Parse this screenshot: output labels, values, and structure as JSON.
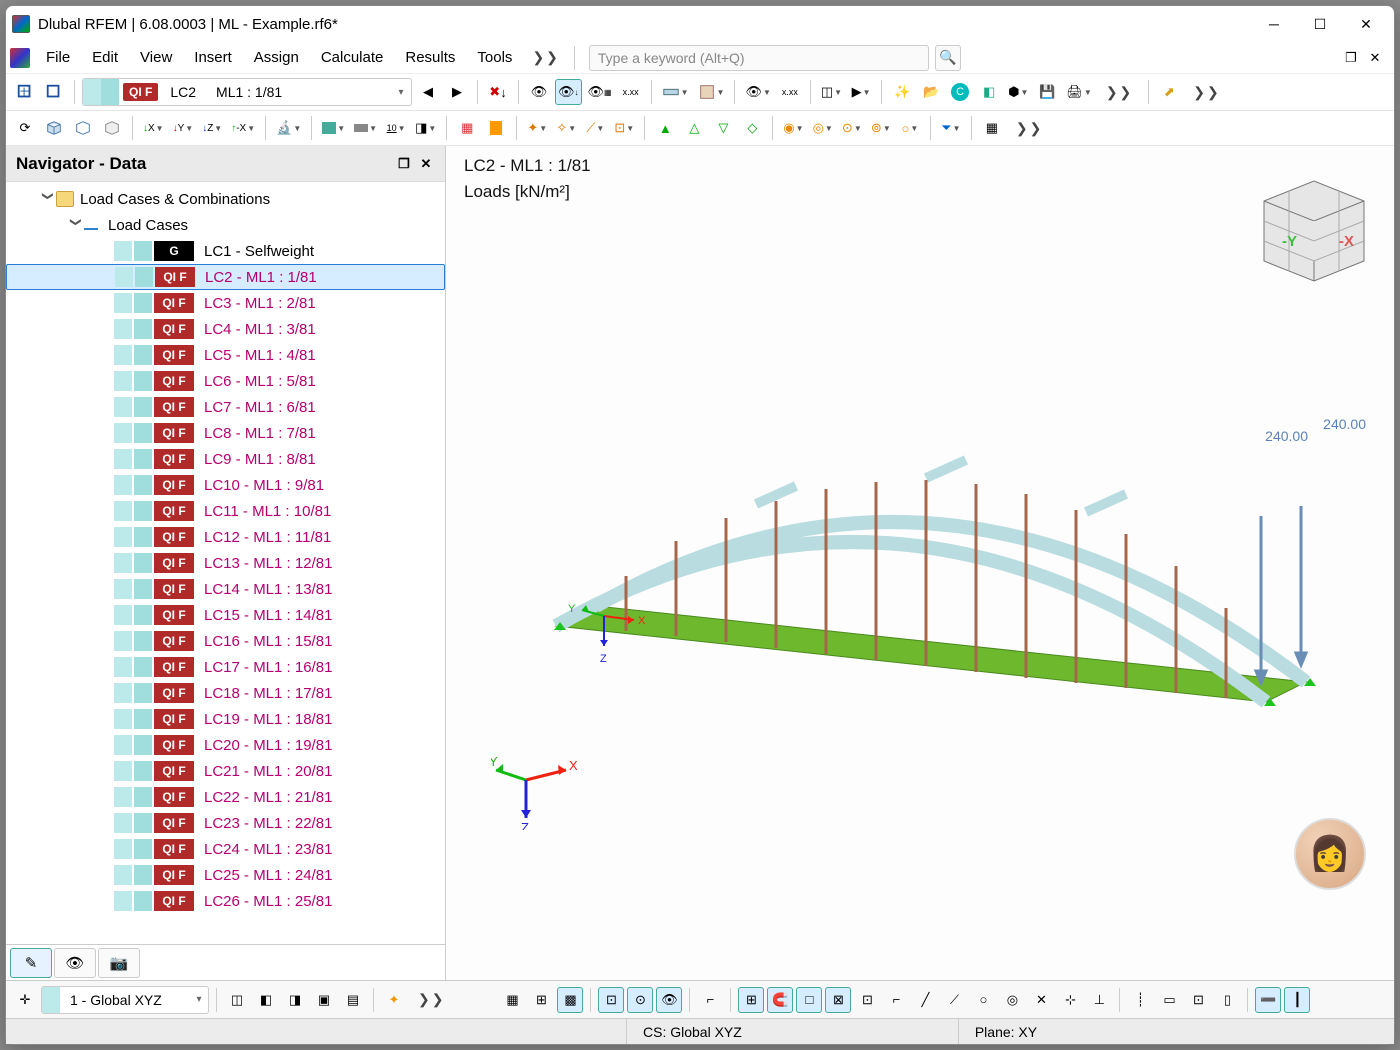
{
  "title": "Dlubal RFEM | 6.08.0003 | ML - Example.rf6*",
  "menu": {
    "file": "File",
    "edit": "Edit",
    "view": "View",
    "insert": "Insert",
    "assign": "Assign",
    "calculate": "Calculate",
    "results": "Results",
    "tools": "Tools"
  },
  "search": {
    "placeholder": "Type a keyword (Alt+Q)"
  },
  "toolbar1": {
    "lc_badge": "QI F",
    "lc_code": "LC2",
    "lc_desc": "ML1 : 1/81"
  },
  "navigator": {
    "title": "Navigator - Data",
    "group": "Load Cases & Combinations",
    "subgroup": "Load Cases",
    "items": [
      {
        "cat": "G",
        "catClass": "g",
        "label": "LC1 - Selfweight",
        "first": true
      },
      {
        "cat": "QI F",
        "catClass": "qif",
        "label": "LC2 - ML1 : 1/81",
        "selected": true
      },
      {
        "cat": "QI F",
        "catClass": "qif",
        "label": "LC3 - ML1 : 2/81"
      },
      {
        "cat": "QI F",
        "catClass": "qif",
        "label": "LC4 - ML1 : 3/81"
      },
      {
        "cat": "QI F",
        "catClass": "qif",
        "label": "LC5 - ML1 : 4/81"
      },
      {
        "cat": "QI F",
        "catClass": "qif",
        "label": "LC6 - ML1 : 5/81"
      },
      {
        "cat": "QI F",
        "catClass": "qif",
        "label": "LC7 - ML1 : 6/81"
      },
      {
        "cat": "QI F",
        "catClass": "qif",
        "label": "LC8 - ML1 : 7/81"
      },
      {
        "cat": "QI F",
        "catClass": "qif",
        "label": "LC9 - ML1 : 8/81"
      },
      {
        "cat": "QI F",
        "catClass": "qif",
        "label": "LC10 - ML1 : 9/81"
      },
      {
        "cat": "QI F",
        "catClass": "qif",
        "label": "LC11 - ML1 : 10/81"
      },
      {
        "cat": "QI F",
        "catClass": "qif",
        "label": "LC12 - ML1 : 11/81"
      },
      {
        "cat": "QI F",
        "catClass": "qif",
        "label": "LC13 - ML1 : 12/81"
      },
      {
        "cat": "QI F",
        "catClass": "qif",
        "label": "LC14 - ML1 : 13/81"
      },
      {
        "cat": "QI F",
        "catClass": "qif",
        "label": "LC15 - ML1 : 14/81"
      },
      {
        "cat": "QI F",
        "catClass": "qif",
        "label": "LC16 - ML1 : 15/81"
      },
      {
        "cat": "QI F",
        "catClass": "qif",
        "label": "LC17 - ML1 : 16/81"
      },
      {
        "cat": "QI F",
        "catClass": "qif",
        "label": "LC18 - ML1 : 17/81"
      },
      {
        "cat": "QI F",
        "catClass": "qif",
        "label": "LC19 - ML1 : 18/81"
      },
      {
        "cat": "QI F",
        "catClass": "qif",
        "label": "LC20 - ML1 : 19/81"
      },
      {
        "cat": "QI F",
        "catClass": "qif",
        "label": "LC21 - ML1 : 20/81"
      },
      {
        "cat": "QI F",
        "catClass": "qif",
        "label": "LC22 - ML1 : 21/81"
      },
      {
        "cat": "QI F",
        "catClass": "qif",
        "label": "LC23 - ML1 : 22/81"
      },
      {
        "cat": "QI F",
        "catClass": "qif",
        "label": "LC24 - ML1 : 23/81"
      },
      {
        "cat": "QI F",
        "catClass": "qif",
        "label": "LC25 - ML1 : 24/81"
      },
      {
        "cat": "QI F",
        "catClass": "qif",
        "label": "LC26 - ML1 : 25/81"
      }
    ]
  },
  "viewport": {
    "label": "LC2 - ML1 : 1/81",
    "sublabel": "Loads [kN/m²]",
    "load1": "240.00",
    "load2": "240.00",
    "axes": {
      "x": "X",
      "y": "Y",
      "z": "Z"
    },
    "cube": {
      "x": "-X",
      "y": "-Y"
    }
  },
  "bottom": {
    "workplane": "1 - Global XYZ"
  },
  "status": {
    "cs": "CS: Global XYZ",
    "plane": "Plane: XY"
  }
}
